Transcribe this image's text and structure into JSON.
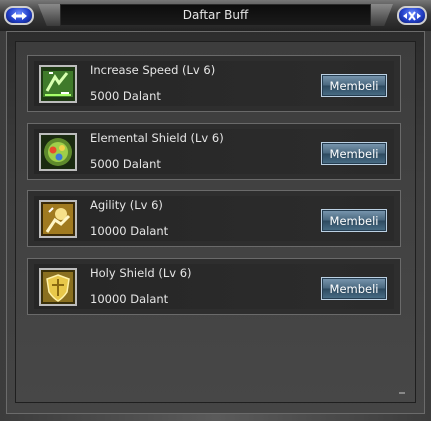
{
  "window": {
    "title": "Daftar Buff"
  },
  "titlebar": {
    "left_button_icon": "swap-arrows-icon",
    "right_button_icon": "close-x-icon"
  },
  "buffs": [
    {
      "name": "Increase Speed (Lv 6)",
      "price": "5000 Dalant",
      "icon": "speed-icon",
      "button_label": "Membeli"
    },
    {
      "name": "Elemental Shield (Lv 6)",
      "price": "5000 Dalant",
      "icon": "elemental-orb-icon",
      "button_label": "Membeli"
    },
    {
      "name": "Agility (Lv 6)",
      "price": "10000 Dalant",
      "icon": "agility-icon",
      "button_label": "Membeli"
    },
    {
      "name": "Holy Shield (Lv 6)",
      "price": "10000 Dalant",
      "icon": "holy-shield-icon",
      "button_label": "Membeli"
    }
  ]
}
